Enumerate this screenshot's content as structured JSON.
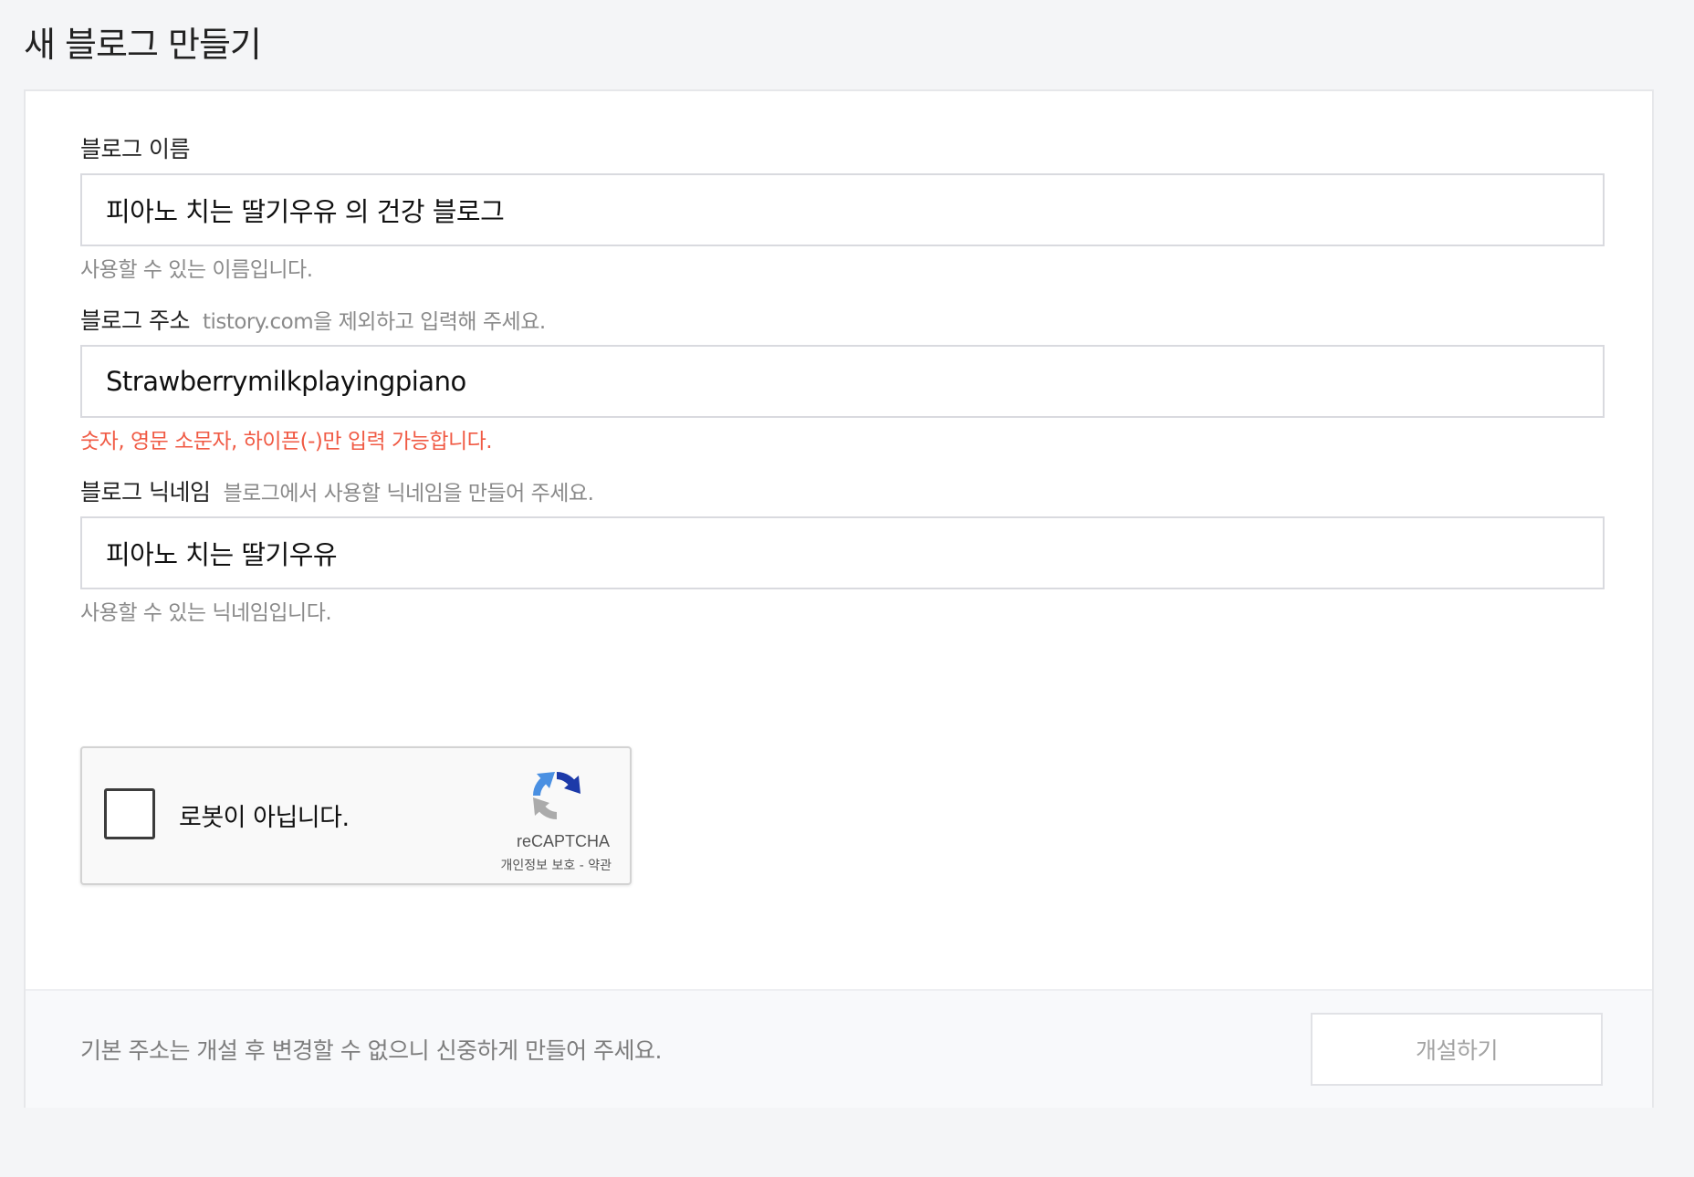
{
  "page": {
    "title": "새 블로그 만들기"
  },
  "form": {
    "blog_name": {
      "label": "블로그 이름",
      "value": "피아노 치는 딸기우유 의 건강 블로그",
      "helper": "사용할 수 있는 이름입니다.",
      "helper_status": "ok"
    },
    "blog_address": {
      "label": "블로그 주소",
      "hint": "tistory.com을 제외하고 입력해 주세요.",
      "value": "Strawberrymilkplayingpiano",
      "helper": "숫자, 영문 소문자, 하이픈(-)만 입력 가능합니다.",
      "helper_status": "error"
    },
    "blog_nickname": {
      "label": "블로그 닉네임",
      "hint": "블로그에서 사용할 닉네임을 만들어 주세요.",
      "value": "피아노 치는 딸기우유",
      "helper": "사용할 수 있는 닉네임입니다.",
      "helper_status": "ok"
    }
  },
  "recaptcha": {
    "label": "로봇이 아닙니다.",
    "brand": "reCAPTCHA",
    "links": "개인정보 보호 - 약관",
    "checked": false
  },
  "footer": {
    "note": "기본 주소는 개설 후 변경할 수 없으니 신중하게 만들어 주세요.",
    "submit_label": "개설하기"
  },
  "colors": {
    "background": "#f4f5f7",
    "error": "#f05a44",
    "hint": "#8a8a8a",
    "button_text_disabled": "#a3a3a3"
  }
}
